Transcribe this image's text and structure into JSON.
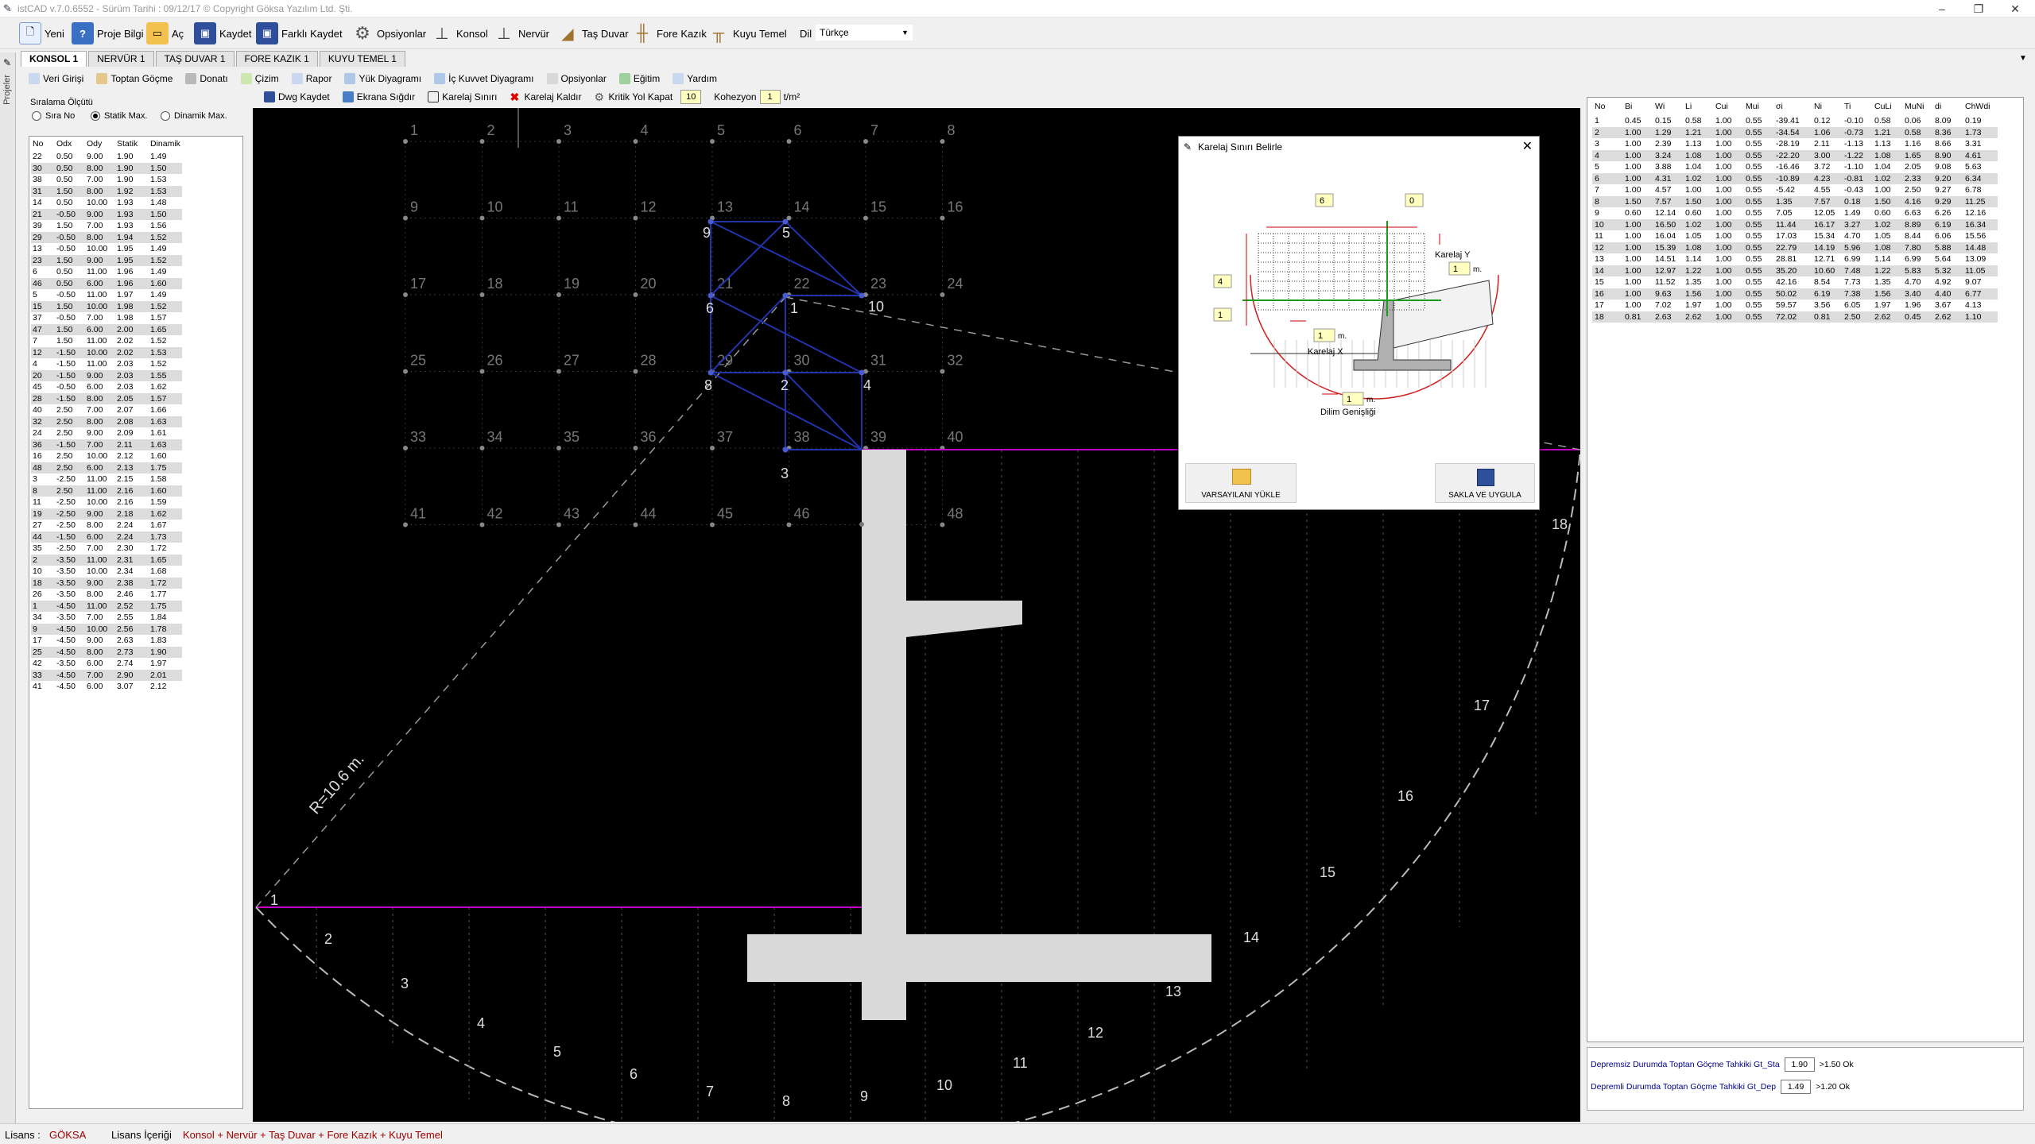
{
  "window": {
    "title": "istCAD v.7.0.6552 - Sürüm Tarihi : 09/12/17  © Copyright Göksa Yazılım Ltd. Şti."
  },
  "toolbar": {
    "items": [
      "Yeni",
      "Proje Bilgi",
      "Aç",
      "Kaydet",
      "Farklı Kaydet",
      "Opsiyonlar",
      "Konsol",
      "Nervür",
      "Taş Duvar",
      "Fore Kazık",
      "Kuyu Temel"
    ],
    "dil_label": "Dil",
    "dil_value": "Türkçe"
  },
  "tabs": [
    "KONSOL 1",
    "NERVÜR 1",
    "TAŞ DUVAR 1",
    "FORE KAZIK 1",
    "KUYU TEMEL 1"
  ],
  "side_strip_label": "Projeler",
  "subtoolbar": [
    "Veri Girişi",
    "Toptan Göçme",
    "Donatı",
    "Çizim",
    "Rapor",
    "Yük Diyagramı",
    "İç Kuvvet Diyagramı",
    "Opsiyonlar",
    "Eğitim",
    "Yardım"
  ],
  "drawtoolbar": {
    "items": [
      "Dwg Kaydet",
      "Ekrana Sığdır",
      "Karelaj Sınırı",
      "Karelaj Kaldır",
      "Kritik Yol Kapat"
    ],
    "kritik_value": "10",
    "kohezyon_label": "Kohezyon",
    "kohezyon_value": "1",
    "kohezyon_unit": "t/m²"
  },
  "sort": {
    "group_label": "Sıralama Ölçütü",
    "options": [
      "Sıra No",
      "Statik Max.",
      "Dinamik Max."
    ],
    "selected": 1
  },
  "left_table": {
    "headers": [
      "No",
      "Odx",
      "Ody",
      "Statik",
      "Dinamik"
    ],
    "rows": [
      [
        "22",
        "0.50",
        "9.00",
        "1.90",
        "1.49"
      ],
      [
        "30",
        "0.50",
        "8.00",
        "1.90",
        "1.50"
      ],
      [
        "38",
        "0.50",
        "7.00",
        "1.90",
        "1.53"
      ],
      [
        "31",
        "1.50",
        "8.00",
        "1.92",
        "1.53"
      ],
      [
        "14",
        "0.50",
        "10.00",
        "1.93",
        "1.48"
      ],
      [
        "21",
        "-0.50",
        "9.00",
        "1.93",
        "1.50"
      ],
      [
        "39",
        "1.50",
        "7.00",
        "1.93",
        "1.56"
      ],
      [
        "29",
        "-0.50",
        "8.00",
        "1.94",
        "1.52"
      ],
      [
        "13",
        "-0.50",
        "10.00",
        "1.95",
        "1.49"
      ],
      [
        "23",
        "1.50",
        "9.00",
        "1.95",
        "1.52"
      ],
      [
        "6",
        "0.50",
        "11.00",
        "1.96",
        "1.49"
      ],
      [
        "46",
        "0.50",
        "6.00",
        "1.96",
        "1.60"
      ],
      [
        "5",
        "-0.50",
        "11.00",
        "1.97",
        "1.49"
      ],
      [
        "15",
        "1.50",
        "10.00",
        "1.98",
        "1.52"
      ],
      [
        "37",
        "-0.50",
        "7.00",
        "1.98",
        "1.57"
      ],
      [
        "47",
        "1.50",
        "6.00",
        "2.00",
        "1.65"
      ],
      [
        "7",
        "1.50",
        "11.00",
        "2.02",
        "1.52"
      ],
      [
        "12",
        "-1.50",
        "10.00",
        "2.02",
        "1.53"
      ],
      [
        "4",
        "-1.50",
        "11.00",
        "2.03",
        "1.52"
      ],
      [
        "20",
        "-1.50",
        "9.00",
        "2.03",
        "1.55"
      ],
      [
        "45",
        "-0.50",
        "6.00",
        "2.03",
        "1.62"
      ],
      [
        "28",
        "-1.50",
        "8.00",
        "2.05",
        "1.57"
      ],
      [
        "40",
        "2.50",
        "7.00",
        "2.07",
        "1.66"
      ],
      [
        "32",
        "2.50",
        "8.00",
        "2.08",
        "1.63"
      ],
      [
        "24",
        "2.50",
        "9.00",
        "2.09",
        "1.61"
      ],
      [
        "36",
        "-1.50",
        "7.00",
        "2.11",
        "1.63"
      ],
      [
        "16",
        "2.50",
        "10.00",
        "2.12",
        "1.60"
      ],
      [
        "48",
        "2.50",
        "6.00",
        "2.13",
        "1.75"
      ],
      [
        "3",
        "-2.50",
        "11.00",
        "2.15",
        "1.58"
      ],
      [
        "8",
        "2.50",
        "11.00",
        "2.16",
        "1.60"
      ],
      [
        "11",
        "-2.50",
        "10.00",
        "2.16",
        "1.59"
      ],
      [
        "19",
        "-2.50",
        "9.00",
        "2.18",
        "1.62"
      ],
      [
        "27",
        "-2.50",
        "8.00",
        "2.24",
        "1.67"
      ],
      [
        "44",
        "-1.50",
        "6.00",
        "2.24",
        "1.73"
      ],
      [
        "35",
        "-2.50",
        "7.00",
        "2.30",
        "1.72"
      ],
      [
        "2",
        "-3.50",
        "11.00",
        "2.31",
        "1.65"
      ],
      [
        "10",
        "-3.50",
        "10.00",
        "2.34",
        "1.68"
      ],
      [
        "18",
        "-3.50",
        "9.00",
        "2.38",
        "1.72"
      ],
      [
        "26",
        "-3.50",
        "8.00",
        "2.46",
        "1.77"
      ],
      [
        "1",
        "-4.50",
        "11.00",
        "2.52",
        "1.75"
      ],
      [
        "34",
        "-3.50",
        "7.00",
        "2.55",
        "1.84"
      ],
      [
        "9",
        "-4.50",
        "10.00",
        "2.56",
        "1.78"
      ],
      [
        "17",
        "-4.50",
        "9.00",
        "2.63",
        "1.83"
      ],
      [
        "25",
        "-4.50",
        "8.00",
        "2.73",
        "1.90"
      ],
      [
        "42",
        "-3.50",
        "6.00",
        "2.74",
        "1.97"
      ],
      [
        "33",
        "-4.50",
        "7.00",
        "2.90",
        "2.01"
      ],
      [
        "41",
        "-4.50",
        "6.00",
        "3.07",
        "2.12"
      ]
    ]
  },
  "canvas": {
    "grid_labels": [
      "1",
      "2",
      "3",
      "4",
      "5",
      "6",
      "7",
      "8",
      "9",
      "10",
      "11",
      "12",
      "13",
      "14",
      "15",
      "16",
      "17",
      "18",
      "19",
      "20",
      "21",
      "22",
      "23",
      "24",
      "25",
      "26",
      "27",
      "28",
      "29",
      "30",
      "31",
      "32",
      "33",
      "34",
      "35",
      "36",
      "37",
      "38",
      "39",
      "40",
      "41",
      "42",
      "43",
      "44",
      "45",
      "46",
      "47",
      "48"
    ],
    "path_labels": [
      "9",
      "5",
      "6",
      "1",
      "10",
      "8",
      "2",
      "4",
      "3"
    ],
    "slice_labels": [
      "1",
      "2",
      "3",
      "4",
      "5",
      "6",
      "7",
      "8",
      "9",
      "10",
      "11",
      "12",
      "13",
      "14",
      "15",
      "16",
      "17",
      "18"
    ],
    "radius_label": "R=10.6 m."
  },
  "dialog": {
    "title": "Karelaj Sınırı Belirle",
    "top_val": "6",
    "top_right_val": "0",
    "left_val": "4",
    "left_val2": "1",
    "karelaj_y_label": "Karelaj Y",
    "karelaj_y_val": "1",
    "karelaj_x_label": "Karelaj  X",
    "karelaj_x_val": "1",
    "dilim_label": "Dilim Genişliği",
    "dilim_val": "1",
    "unit": "m.",
    "btn_load": "VARSAYILANI YÜKLE",
    "btn_save": "SAKLA VE UYGULA"
  },
  "right_table": {
    "headers": [
      "No",
      "Bi",
      "Wi",
      "Li",
      "Cui",
      "Mui",
      "σi",
      "Ni",
      "Ti",
      "CuLi",
      "MuNi",
      "di",
      "ChWdi"
    ],
    "rows": [
      [
        "1",
        "0.45",
        "0.15",
        "0.58",
        "1.00",
        "0.55",
        "-39.41",
        "0.12",
        "-0.10",
        "0.58",
        "0.06",
        "8.09",
        "0.19"
      ],
      [
        "2",
        "1.00",
        "1.29",
        "1.21",
        "1.00",
        "0.55",
        "-34.54",
        "1.06",
        "-0.73",
        "1.21",
        "0.58",
        "8.36",
        "1.73"
      ],
      [
        "3",
        "1.00",
        "2.39",
        "1.13",
        "1.00",
        "0.55",
        "-28.19",
        "2.11",
        "-1.13",
        "1.13",
        "1.16",
        "8.66",
        "3.31"
      ],
      [
        "4",
        "1.00",
        "3.24",
        "1.08",
        "1.00",
        "0.55",
        "-22.20",
        "3.00",
        "-1.22",
        "1.08",
        "1.65",
        "8.90",
        "4.61"
      ],
      [
        "5",
        "1.00",
        "3.88",
        "1.04",
        "1.00",
        "0.55",
        "-16.46",
        "3.72",
        "-1.10",
        "1.04",
        "2.05",
        "9.08",
        "5.63"
      ],
      [
        "6",
        "1.00",
        "4.31",
        "1.02",
        "1.00",
        "0.55",
        "-10.89",
        "4.23",
        "-0.81",
        "1.02",
        "2.33",
        "9.20",
        "6.34"
      ],
      [
        "7",
        "1.00",
        "4.57",
        "1.00",
        "1.00",
        "0.55",
        "-5.42",
        "4.55",
        "-0.43",
        "1.00",
        "2.50",
        "9.27",
        "6.78"
      ],
      [
        "8",
        "1.50",
        "7.57",
        "1.50",
        "1.00",
        "0.55",
        "1.35",
        "7.57",
        "0.18",
        "1.50",
        "4.16",
        "9.29",
        "11.25"
      ],
      [
        "9",
        "0.60",
        "12.14",
        "0.60",
        "1.00",
        "0.55",
        "7.05",
        "12.05",
        "1.49",
        "0.60",
        "6.63",
        "6.26",
        "12.16"
      ],
      [
        "10",
        "1.00",
        "16.50",
        "1.02",
        "1.00",
        "0.55",
        "11.44",
        "16.17",
        "3.27",
        "1.02",
        "8.89",
        "6.19",
        "16.34"
      ],
      [
        "11",
        "1.00",
        "16.04",
        "1.05",
        "1.00",
        "0.55",
        "17.03",
        "15.34",
        "4.70",
        "1.05",
        "8.44",
        "6.06",
        "15.56"
      ],
      [
        "12",
        "1.00",
        "15.39",
        "1.08",
        "1.00",
        "0.55",
        "22.79",
        "14.19",
        "5.96",
        "1.08",
        "7.80",
        "5.88",
        "14.48"
      ],
      [
        "13",
        "1.00",
        "14.51",
        "1.14",
        "1.00",
        "0.55",
        "28.81",
        "12.71",
        "6.99",
        "1.14",
        "6.99",
        "5.64",
        "13.09"
      ],
      [
        "14",
        "1.00",
        "12.97",
        "1.22",
        "1.00",
        "0.55",
        "35.20",
        "10.60",
        "7.48",
        "1.22",
        "5.83",
        "5.32",
        "11.05"
      ],
      [
        "15",
        "1.00",
        "11.52",
        "1.35",
        "1.00",
        "0.55",
        "42.16",
        "8.54",
        "7.73",
        "1.35",
        "4.70",
        "4.92",
        "9.07"
      ],
      [
        "16",
        "1.00",
        "9.63",
        "1.56",
        "1.00",
        "0.55",
        "50.02",
        "6.19",
        "7.38",
        "1.56",
        "3.40",
        "4.40",
        "6.77"
      ],
      [
        "17",
        "1.00",
        "7.02",
        "1.97",
        "1.00",
        "0.55",
        "59.57",
        "3.56",
        "6.05",
        "1.97",
        "1.96",
        "3.67",
        "4.13"
      ],
      [
        "18",
        "0.81",
        "2.63",
        "2.62",
        "1.00",
        "0.55",
        "72.02",
        "0.81",
        "2.50",
        "2.62",
        "0.45",
        "2.62",
        "1.10"
      ]
    ]
  },
  "checks": {
    "static_label": "Depremsiz Durumda Toptan Göçme Tahkiki   Gt_Sta",
    "static_val": "1.90",
    "static_res": ">1.50 Ok",
    "dyn_label": "Depremli Durumda Toptan Göçme Tahkiki   Gt_Dep",
    "dyn_val": "1.49",
    "dyn_res": ">1.20 Ok"
  },
  "status": {
    "lisans_label": "Lisans :",
    "lisans_val": "GÖKSA",
    "icerik_label": "Lisans İçeriği",
    "icerik_val": "Konsol + Nervür + Taş Duvar + Fore Kazık + Kuyu Temel"
  },
  "colors": {
    "accent": "#1f3b8c",
    "magenta": "#c000c0",
    "status_red": "#a00000",
    "wall": "#d9d9d9"
  }
}
